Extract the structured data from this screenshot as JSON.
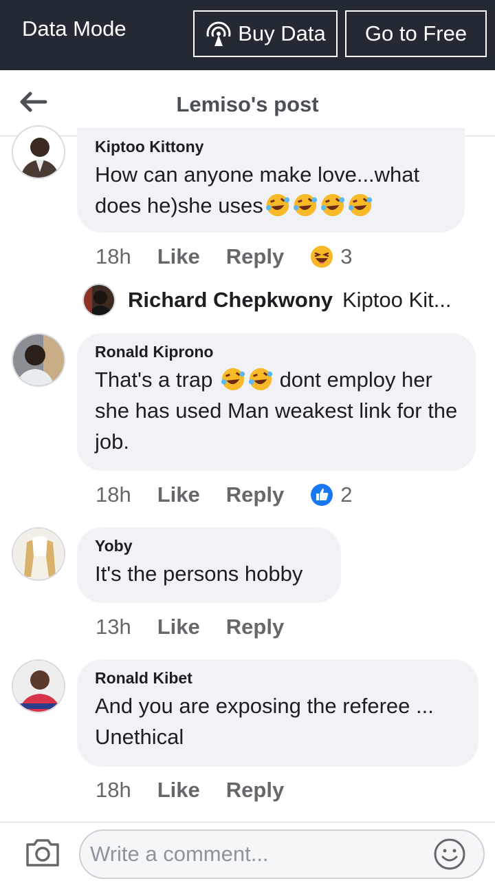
{
  "top_bar": {
    "data_mode_label": "Data Mode",
    "buy_data_label": "Buy Data",
    "go_free_label": "Go to Free"
  },
  "header": {
    "title": "Lemiso's post"
  },
  "comments": [
    {
      "author": "Kiptoo Kittony",
      "text": "How can anyone make love...what does he)she uses",
      "emojis": [
        "rofl-emoji",
        "rofl-emoji",
        "rofl-emoji",
        "rofl-emoji"
      ],
      "time": "18h",
      "like": "Like",
      "reply": "Reply",
      "reaction_icon": "laughing-emoji-icon",
      "reaction_count": "3"
    },
    {
      "author": "Ronald Kiprono",
      "text_before": "That's a trap ",
      "text_after": "  dont employ her she has used Man weakest link for the job.",
      "emojis": [
        "rofl-emoji",
        "rofl-emoji"
      ],
      "time": "18h",
      "like": "Like",
      "reply": "Reply",
      "reaction_icon": "thumbs-up-icon",
      "reaction_count": "2"
    },
    {
      "author": "Yoby",
      "text": "It's the persons hobby",
      "time": "13h",
      "like": "Like",
      "reply": "Reply"
    },
    {
      "author": "Ronald Kibet",
      "text": "And you are exposing the referee ... Unethical",
      "time": "18h",
      "like": "Like",
      "reply": "Reply"
    }
  ],
  "reply_preview": {
    "name": "Richard Chepkwony",
    "snippet": "Kiptoo Kit..."
  },
  "composer": {
    "placeholder": "Write a comment..."
  },
  "colors": {
    "top_bar_bg": "#232a33",
    "bubble_bg": "#f0f2f5",
    "meta_text": "#65676b",
    "like_blue": "#1877f2"
  }
}
